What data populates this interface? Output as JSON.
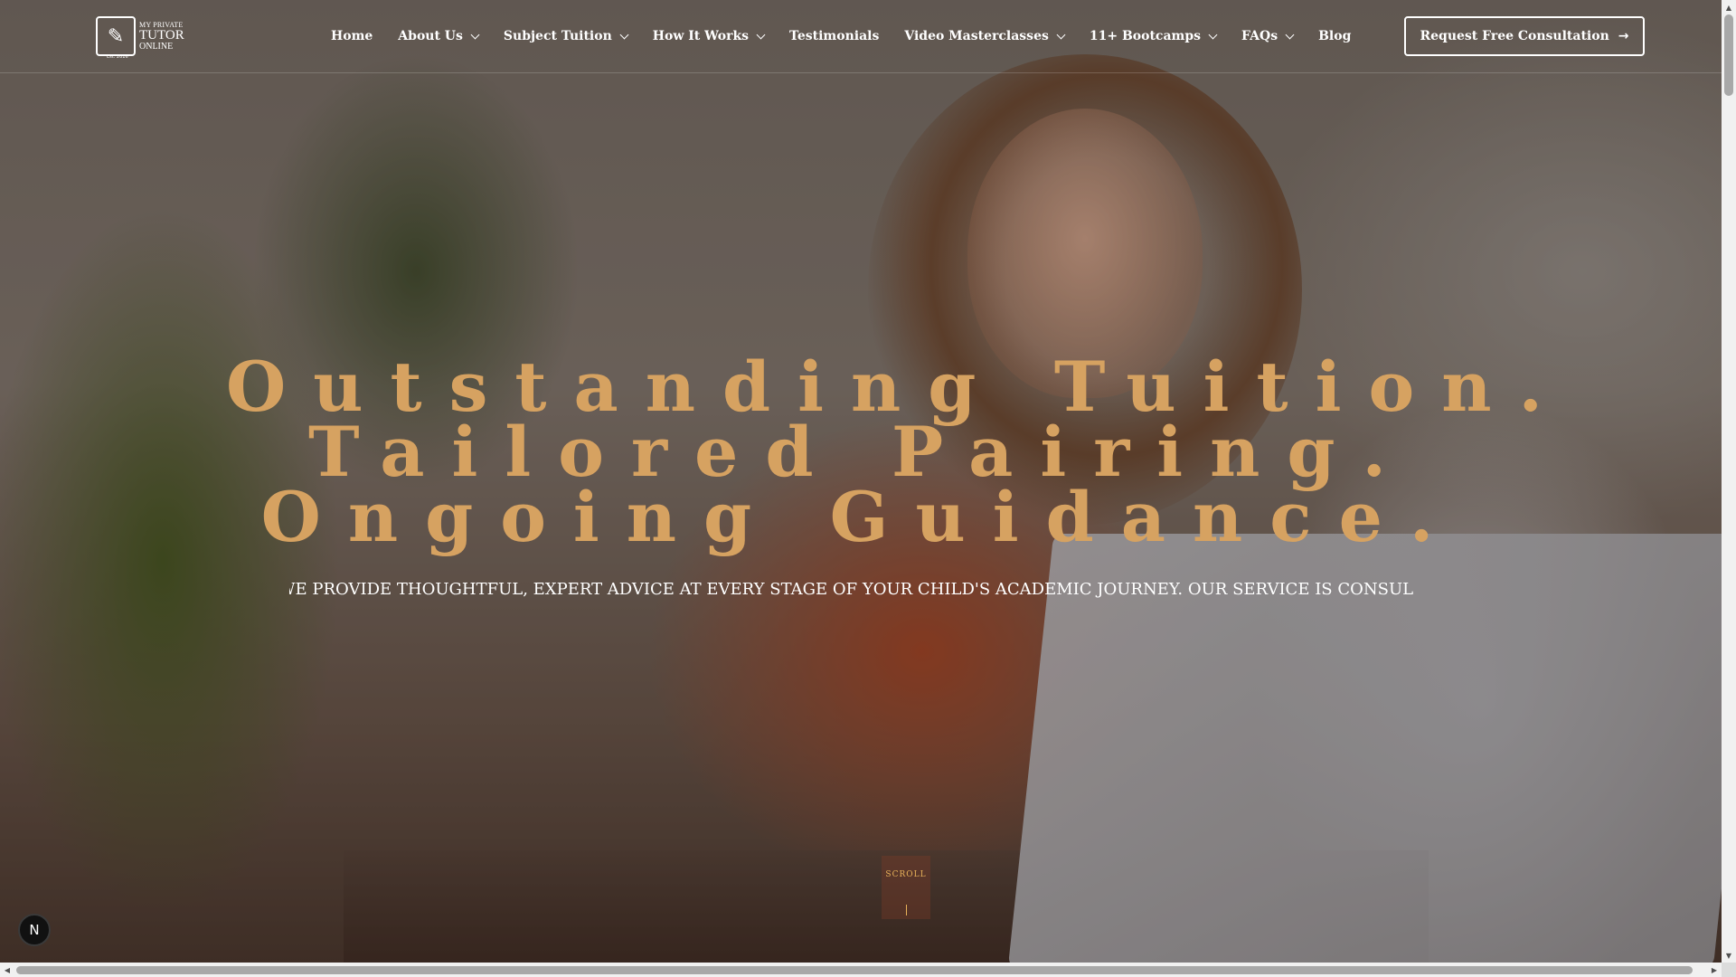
{
  "logo": {
    "line1": "MY PRIVATE",
    "line2": "TUTOR",
    "line3": "ONLINE",
    "est": "Est. 2016",
    "icon": "tutor-logo-icon"
  },
  "nav": {
    "items": [
      {
        "label": "Home",
        "dropdown": false
      },
      {
        "label": "About Us",
        "dropdown": true
      },
      {
        "label": "Subject Tuition",
        "dropdown": true
      },
      {
        "label": "How It Works",
        "dropdown": true
      },
      {
        "label": "Testimonials",
        "dropdown": false
      },
      {
        "label": "Video Masterclasses",
        "dropdown": true
      },
      {
        "label": "11+ Bootcamps",
        "dropdown": true
      },
      {
        "label": "FAQs",
        "dropdown": true
      },
      {
        "label": "Blog",
        "dropdown": false
      }
    ]
  },
  "cta": {
    "label": "Request Free Consultation",
    "icon": "arrow-right-icon"
  },
  "hero": {
    "headline": [
      "Outstanding Tuition.",
      "Tailored Pairing.",
      "Ongoing Guidance."
    ],
    "subline": "WE PROVIDE THOUGHTFUL, EXPERT ADVICE AT EVERY STAGE OF YOUR CHILD'S ACADEMIC JOURNEY. OUR SERVICE IS CONSUL",
    "scroll_label": "SCROLL"
  },
  "badge": {
    "label": "N"
  },
  "colors": {
    "headline": "#d6a261",
    "scroll_accent": "#e8b25a",
    "text": "#ffffff"
  }
}
